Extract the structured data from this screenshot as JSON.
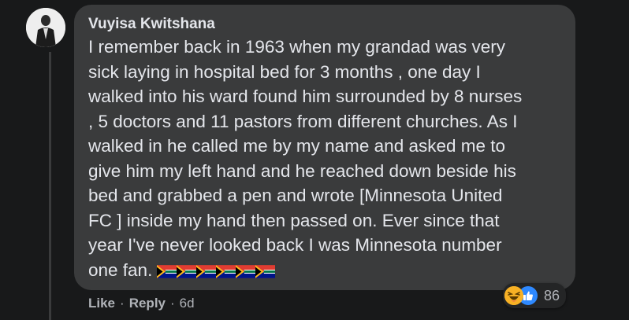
{
  "comment": {
    "author": "Vuyisa Kwitshana",
    "text": "I remember back in 1963 when my grandad was very\nsick laying in hospital bed for 3 months , one day I\nwalked into his ward found him surrounded by 8 nurses\n, 5 doctors and 11 pastors from different churches. As I\nwalked in he called me by my name and asked me to\ngive him my left hand and he reached down beside his\nbed and grabbed a pen and wrote [Minnesota United\nFC ] inside my hand then passed on. Ever since that\nyear I've never looked back I was Minnesota number\none fan.",
    "emoji": [
      "flag-south-africa-icon",
      "flag-south-africa-icon",
      "flag-south-africa-icon",
      "flag-south-africa-icon",
      "flag-south-africa-icon",
      "flag-south-africa-icon"
    ],
    "reactions": {
      "icons": [
        "haha-reaction-icon",
        "like-reaction-icon"
      ],
      "count": "86"
    },
    "actions": {
      "like": "Like",
      "reply": "Reply",
      "separator": "·",
      "age": "6d"
    }
  },
  "colors": {
    "background": "#18191a",
    "bubble": "#3a3b3c",
    "text": "#e4e6eb",
    "secondary_text": "#b0b3b8",
    "like_blue": "#2e89ff",
    "haha_yellow": "#f7b125"
  }
}
